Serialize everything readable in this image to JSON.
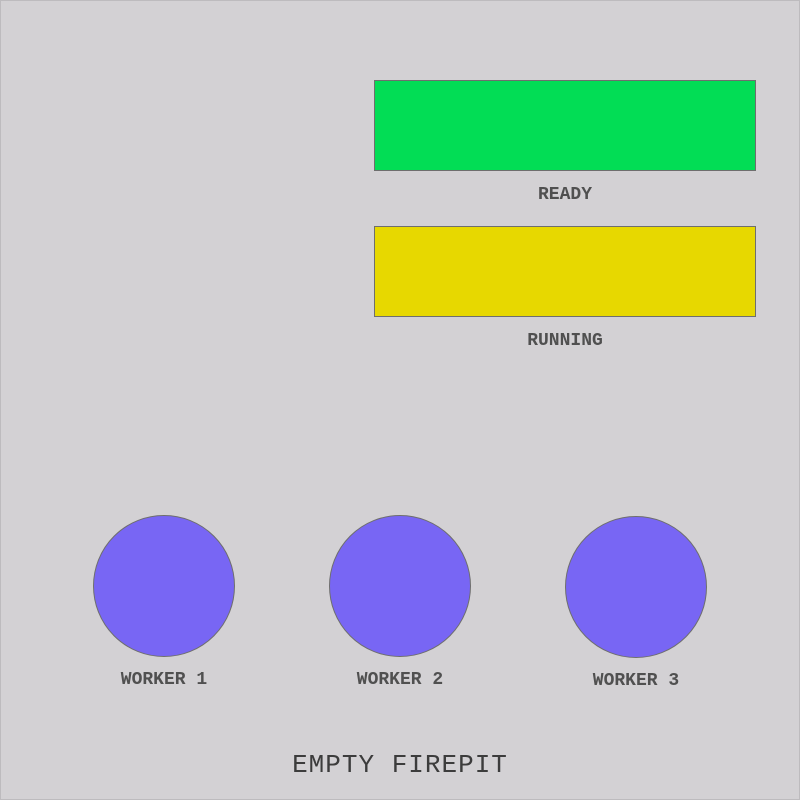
{
  "colors": {
    "background": "#d3d1d4",
    "ready": "#02dd55",
    "running": "#e7d800",
    "worker": "#7866f4",
    "label_text": "#505050",
    "border": "#6e6e6e"
  },
  "queues": {
    "ready": {
      "label": "READY"
    },
    "running": {
      "label": "RUNNING"
    }
  },
  "workers": [
    {
      "label": "WORKER 1"
    },
    {
      "label": "WORKER 2"
    },
    {
      "label": "WORKER 3"
    }
  ],
  "firepit": {
    "label": "EMPTY FIREPIT"
  }
}
